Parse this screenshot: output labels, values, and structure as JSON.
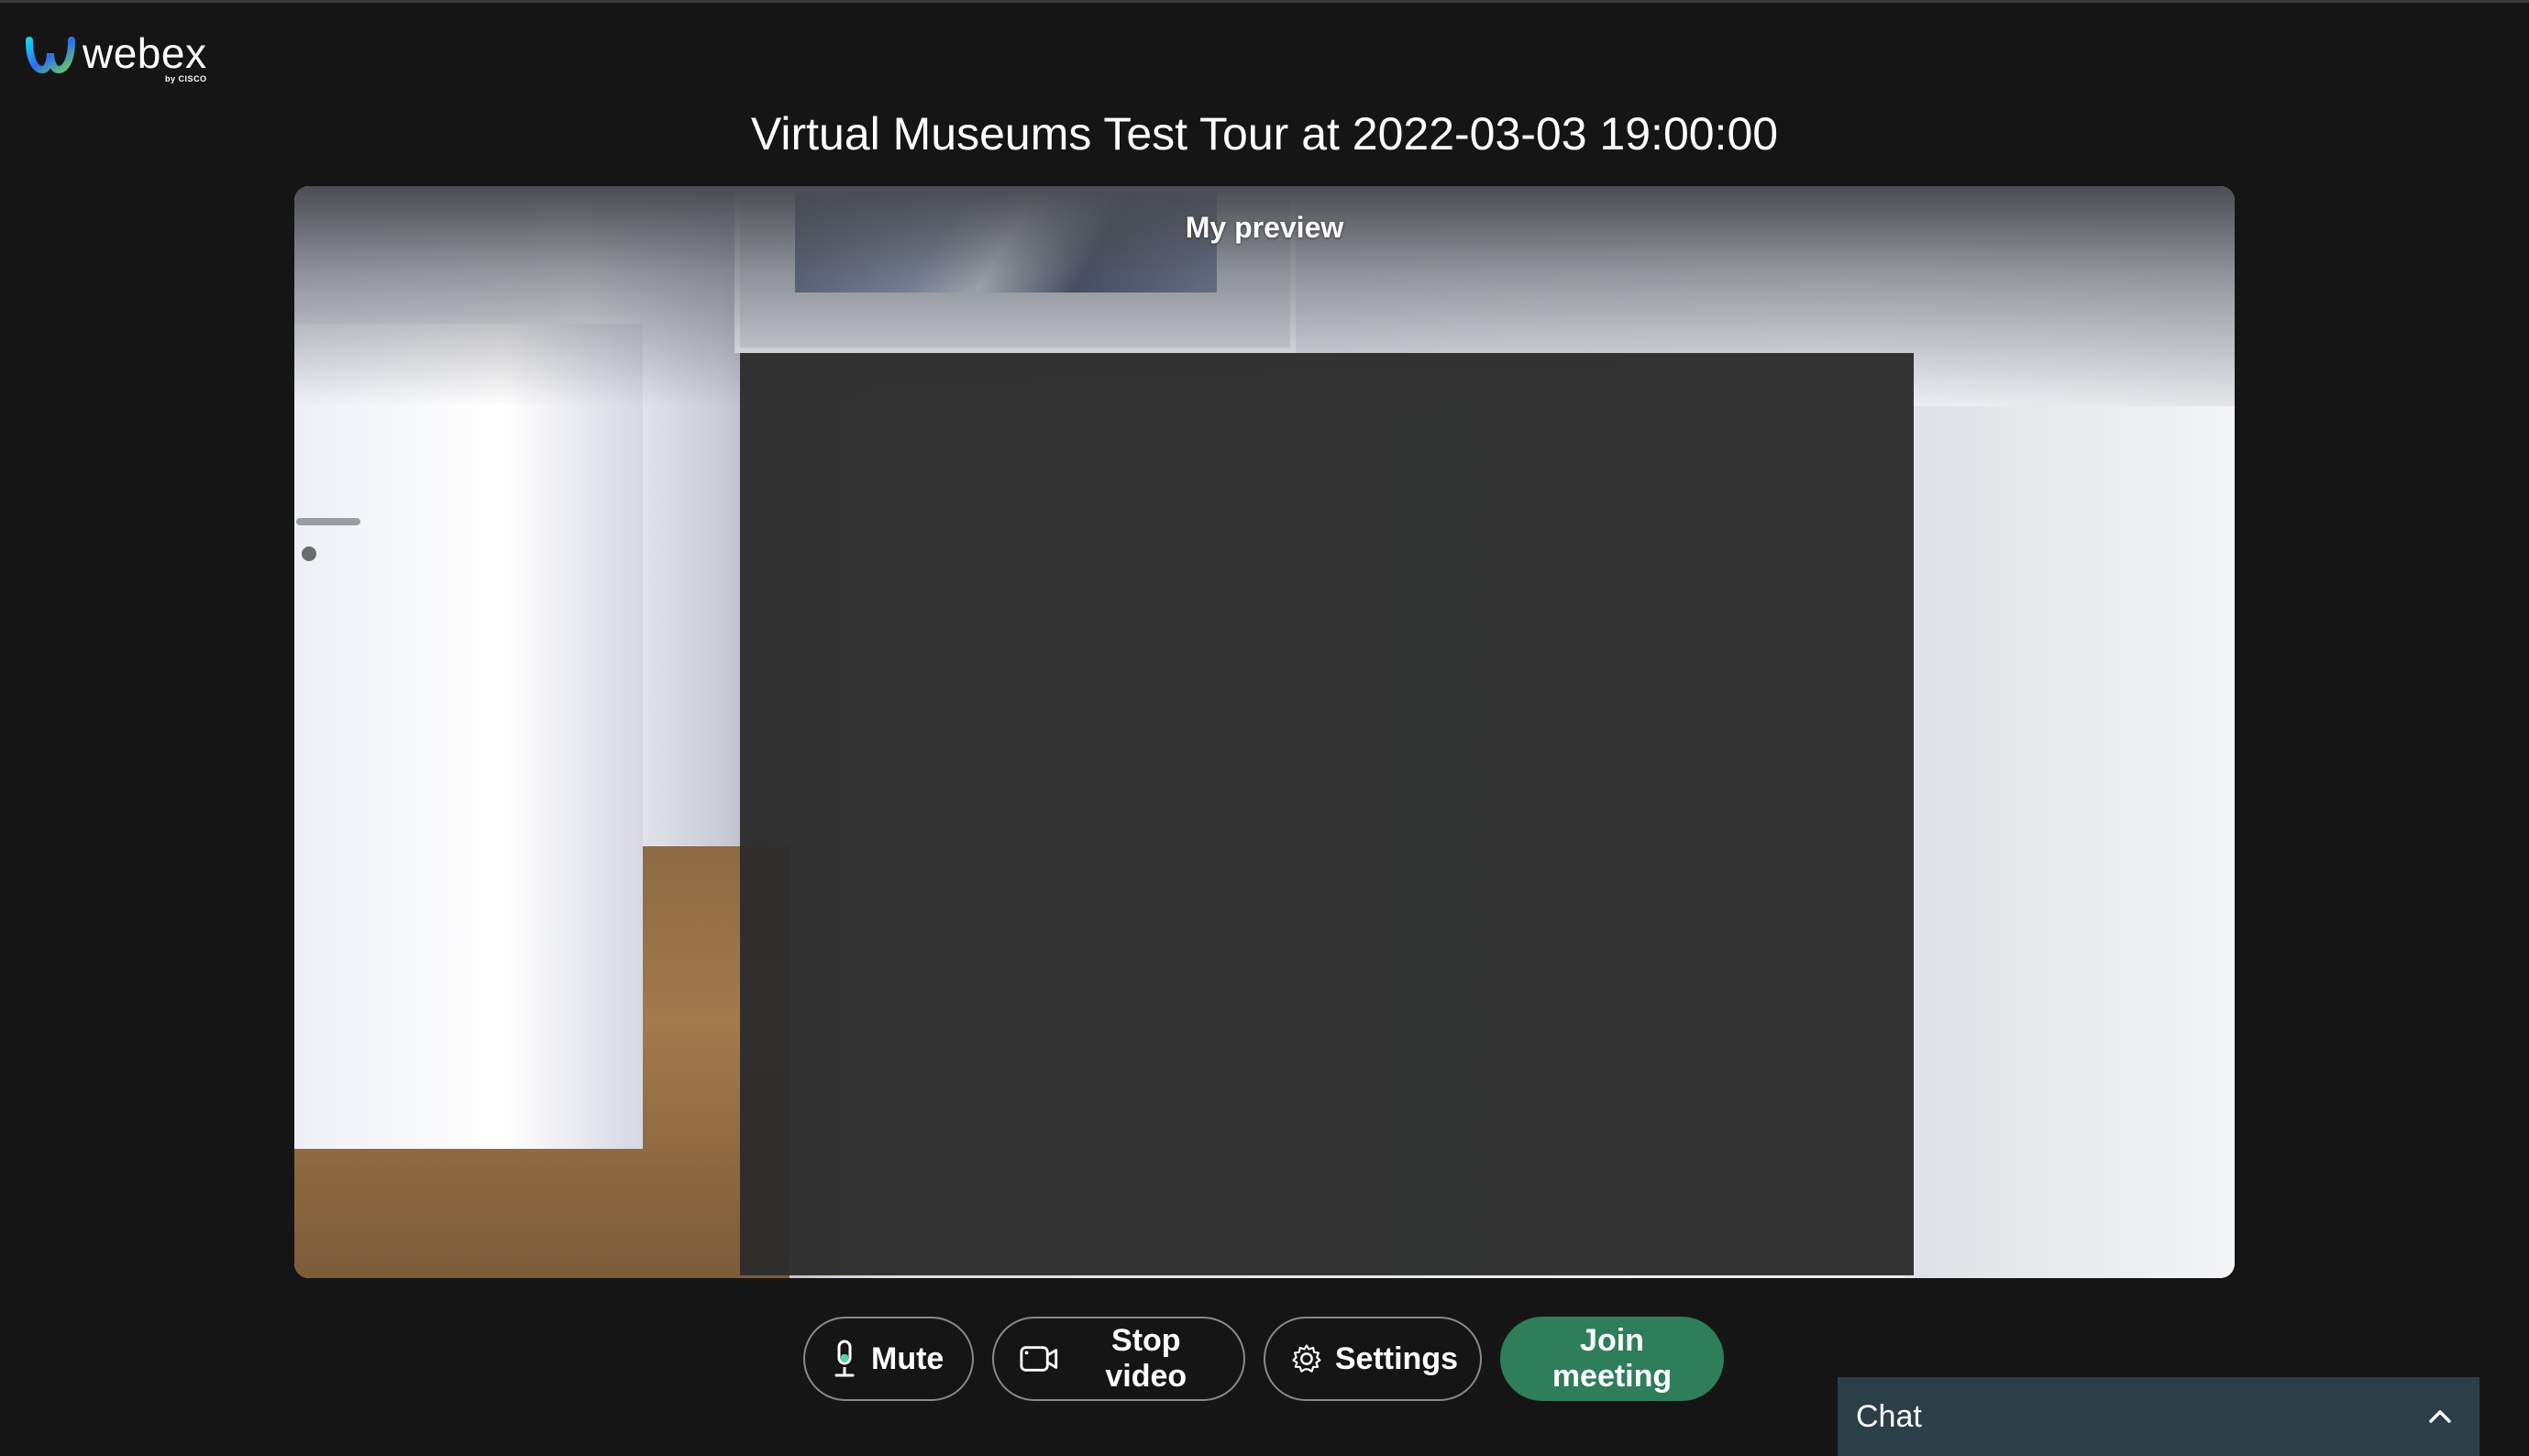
{
  "app": {
    "brand_name": "webex",
    "brand_sub": "by CISCO"
  },
  "meeting": {
    "title": "Virtual Museums Test Tour at 2022-03-03 19:00:00"
  },
  "preview": {
    "label": "My preview"
  },
  "controls": {
    "mute_label": "Mute",
    "mute_icon": "microphone-icon",
    "stop_video_label": "Stop video",
    "stop_video_icon": "camera-icon",
    "settings_label": "Settings",
    "settings_icon": "gear-icon",
    "join_label": "Join meeting"
  },
  "chat": {
    "label": "Chat",
    "toggle_icon": "chevron-up-icon"
  },
  "colors": {
    "background": "#151515",
    "join_button": "#2e7d5b",
    "chat_panel": "#2b3f48"
  }
}
